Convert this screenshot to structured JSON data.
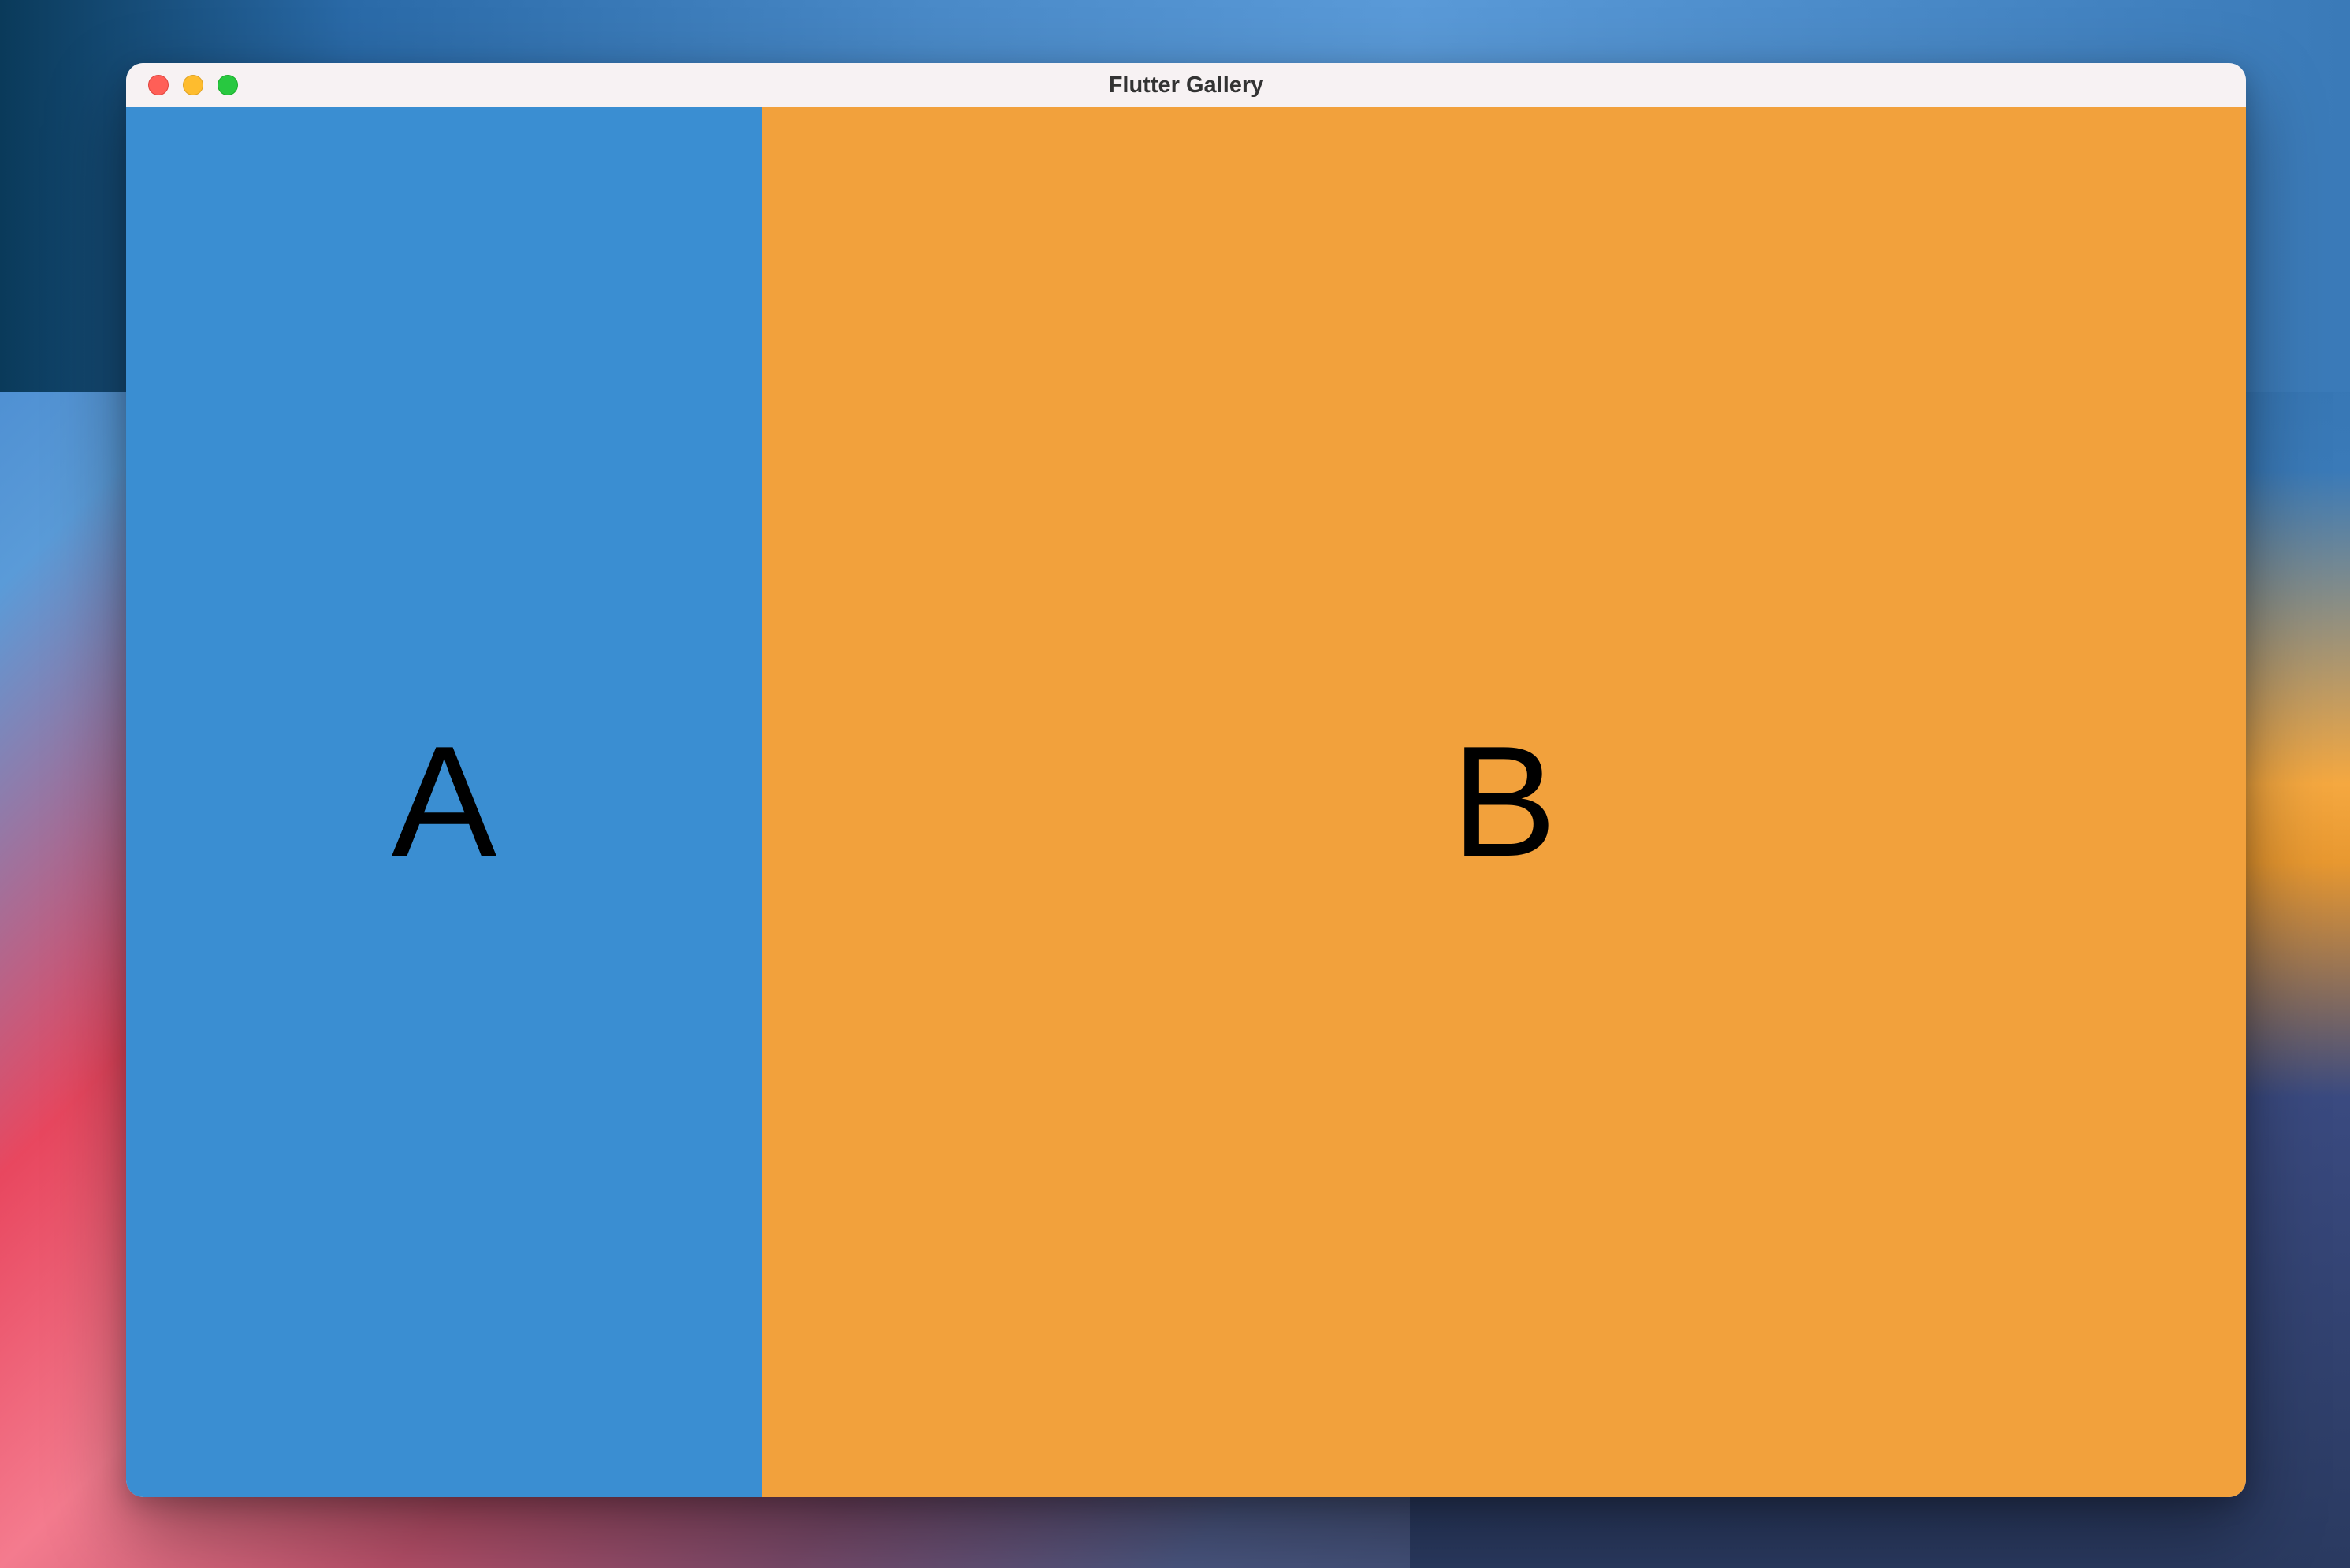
{
  "window": {
    "title": "Flutter Gallery"
  },
  "panels": {
    "a": {
      "label": "A",
      "color": "#3a8ed2"
    },
    "b": {
      "label": "B",
      "color": "#f2a13c"
    }
  }
}
